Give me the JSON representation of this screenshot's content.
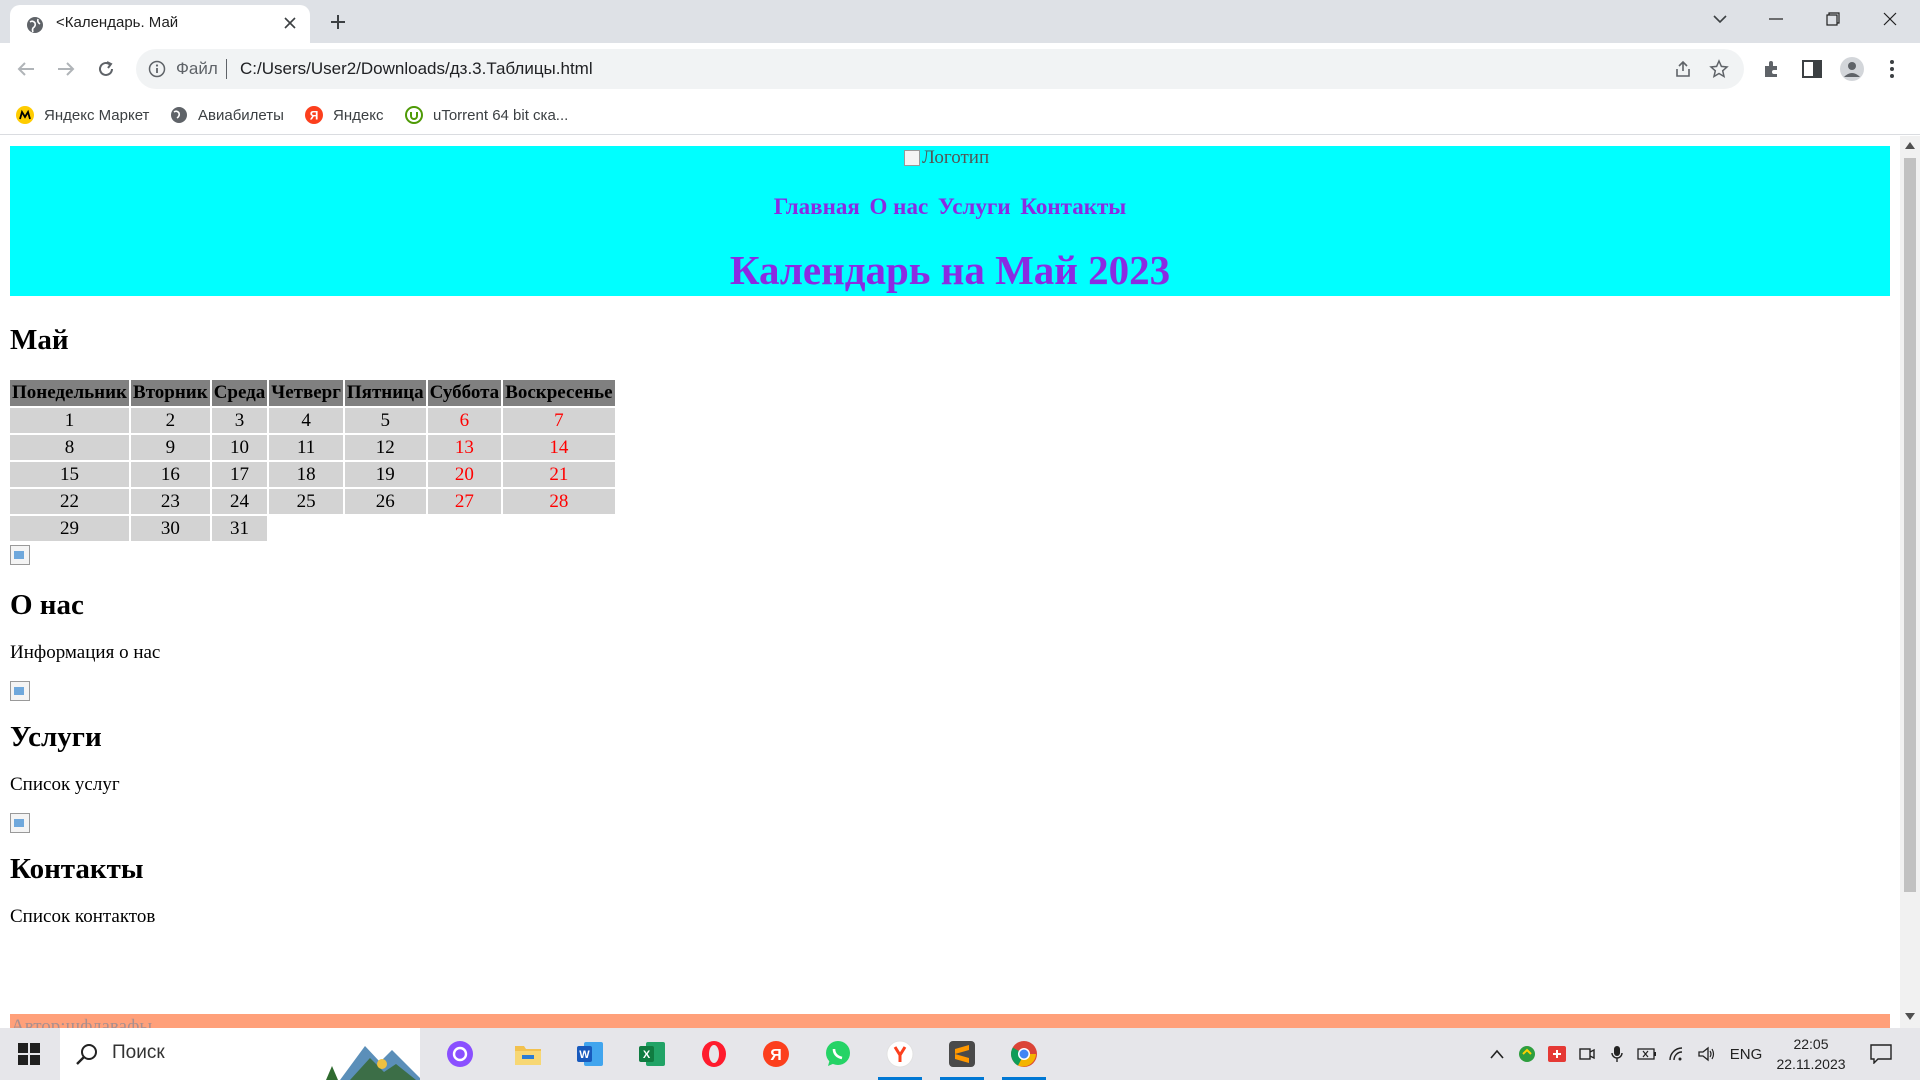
{
  "browser": {
    "tab_title": "<Календарь. Май",
    "omnibox": {
      "file_label": "Файл",
      "url": "C:/Users/User2/Downloads/дз.3.Таблицы.html"
    },
    "bookmarks": [
      {
        "label": "Яндекс Маркет",
        "icon": "yandex-market-icon"
      },
      {
        "label": "Авиабилеты",
        "icon": "globe-icon"
      },
      {
        "label": "Яндекс",
        "icon": "yandex-icon"
      },
      {
        "label": "uTorrent 64 bit ска...",
        "icon": "utorrent-icon"
      }
    ]
  },
  "page": {
    "logo_alt": "Логотип",
    "nav": [
      "Главная",
      "О нас",
      "Услуги",
      "Контакты"
    ],
    "title": "Календарь на Май 2023",
    "month_heading": "Май",
    "calendar": {
      "headers": [
        "Понедельник",
        "Вторник",
        "Среда",
        "Четверг",
        "Пятница",
        "Суббота",
        "Воскресенье"
      ],
      "rows": [
        [
          "1",
          "2",
          "3",
          "4",
          "5",
          "6",
          "7"
        ],
        [
          "8",
          "9",
          "10",
          "11",
          "12",
          "13",
          "14"
        ],
        [
          "15",
          "16",
          "17",
          "18",
          "19",
          "20",
          "21"
        ],
        [
          "22",
          "23",
          "24",
          "25",
          "26",
          "27",
          "28"
        ],
        [
          "29",
          "30",
          "31",
          "",
          "",
          "",
          ""
        ]
      ],
      "weekend_color": "#ff0000"
    },
    "sections": [
      {
        "heading": "О нас",
        "text": "Информация о нас"
      },
      {
        "heading": "Услуги",
        "text": "Список услуг"
      },
      {
        "heading": "Контакты",
        "text": "Список контактов"
      }
    ],
    "footer": "Автор:щфлавафы",
    "colors": {
      "header_bg": "#00ffff",
      "accent": "#8a2be2",
      "footer_bg": "#ffa07a"
    }
  },
  "taskbar": {
    "search_placeholder": "Поиск",
    "apps": [
      "alice-icon",
      "file-explorer-icon",
      "word-icon",
      "excel-icon",
      "opera-icon",
      "yandex-browser-icon",
      "whatsapp-icon",
      "yandex-icon",
      "sublime-text-icon",
      "chrome-icon"
    ],
    "language": "ENG",
    "time": "22:05",
    "date": "22.11.2023"
  }
}
